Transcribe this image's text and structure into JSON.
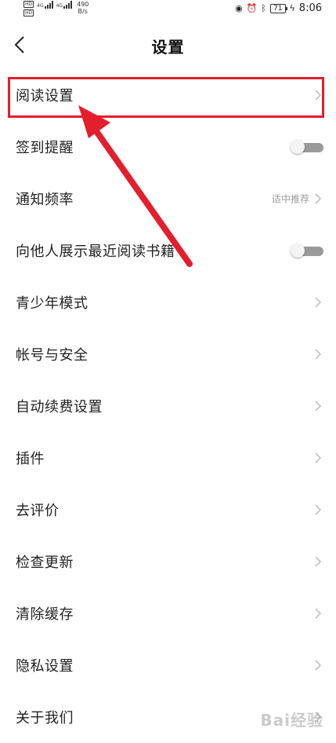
{
  "status_bar": {
    "network_left": "4G",
    "network_right": "4G",
    "speed_value": "490",
    "speed_unit": "B/s",
    "battery": "71",
    "time": "8:06",
    "icons": [
      "eye-icon",
      "alarm-icon",
      "bluetooth-icon",
      "charging-icon"
    ]
  },
  "header": {
    "title": "设置",
    "back_icon": "chevron-left-icon"
  },
  "settings": {
    "items": [
      {
        "label": "阅读设置",
        "control": "chevron"
      },
      {
        "label": "签到提醒",
        "control": "toggle",
        "toggle_on": false
      },
      {
        "label": "通知频率",
        "control": "chevron",
        "value": "适中推荐"
      },
      {
        "label": "向他人展示最近阅读书籍",
        "control": "toggle",
        "toggle_on": false
      },
      {
        "label": "青少年模式",
        "control": "chevron"
      },
      {
        "label": "帐号与安全",
        "control": "chevron"
      },
      {
        "label": "自动续费设置",
        "control": "chevron"
      },
      {
        "label": "插件",
        "control": "chevron"
      },
      {
        "label": "去评价",
        "control": "chevron"
      },
      {
        "label": "检查更新",
        "control": "chevron"
      },
      {
        "label": "清除缓存",
        "control": "chevron"
      },
      {
        "label": "隐私设置",
        "control": "chevron"
      },
      {
        "label": "关于我们",
        "control": "chevron"
      }
    ]
  },
  "annotation": {
    "color": "#e31e2d"
  },
  "watermark": "Bai经验"
}
